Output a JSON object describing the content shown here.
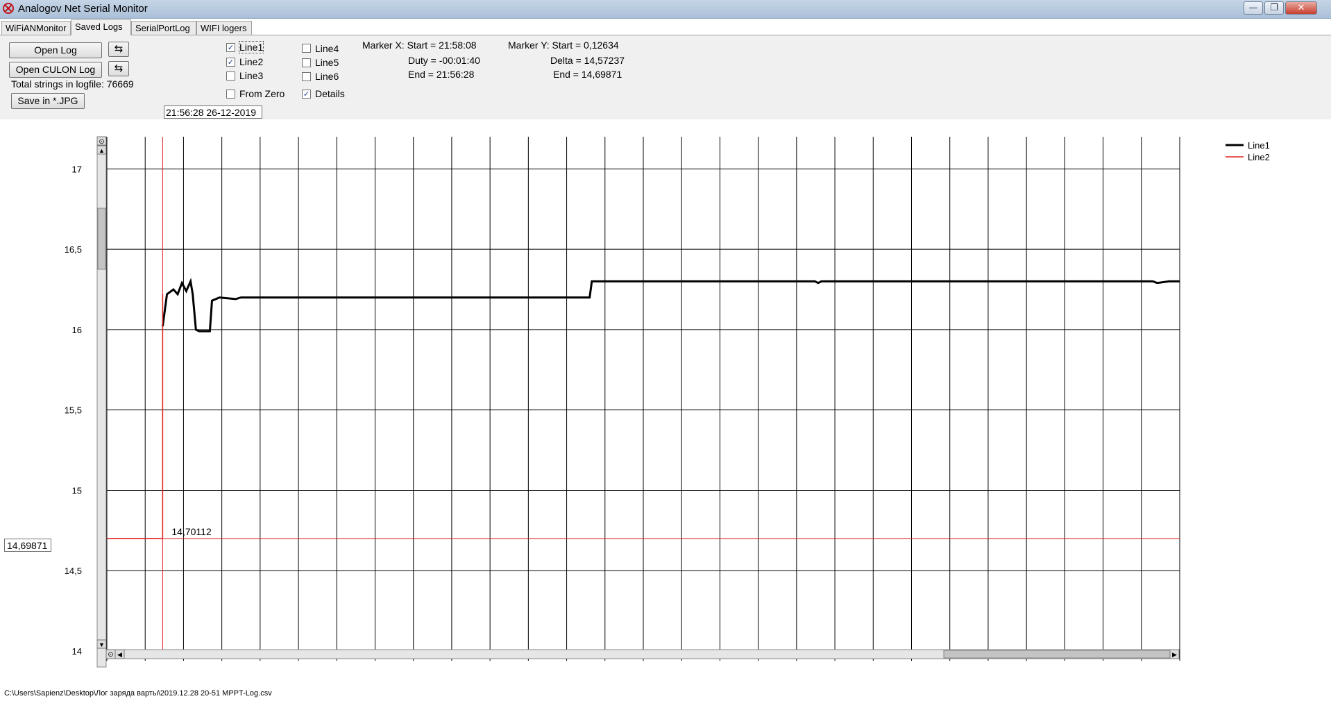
{
  "window": {
    "title": "Analogov Net Serial Monitor",
    "minimize_glyph": "—",
    "maximize_glyph": "❐",
    "close_glyph": "✕"
  },
  "tabs": [
    {
      "label": "WiFiANMonitor",
      "active": false
    },
    {
      "label": "Saved Logs",
      "active": true
    },
    {
      "label": "SerialPortLog",
      "active": false
    },
    {
      "label": "WIFI logers",
      "active": false
    }
  ],
  "controls": {
    "open_log": "Open Log",
    "open_culon_log": "Open CULON Log",
    "total_strings": "Total strings in logfile: 76669",
    "save_jpg": "Save in *.JPG",
    "refresh_glyph": "⇆",
    "date_time": "21:56:28 26-12-2019"
  },
  "checkboxes": [
    {
      "label": "Line1",
      "checked": true
    },
    {
      "label": "Line2",
      "checked": true
    },
    {
      "label": "Line3",
      "checked": false
    },
    {
      "label": "Line4",
      "checked": false
    },
    {
      "label": "Line5",
      "checked": false
    },
    {
      "label": "Line6",
      "checked": false
    },
    {
      "label": "From Zero",
      "checked": false
    },
    {
      "label": "Details",
      "checked": true
    }
  ],
  "marker_x": {
    "start": "Marker X: Start = 21:58:08",
    "duty": "Duty = -00:01:40",
    "end": "End  = 21:56:28"
  },
  "marker_y": {
    "start": "Marker Y: Start = 0,12634",
    "delta": "Delta = 14,57237",
    "end": "End  = 14,69871"
  },
  "plot": {
    "y_cursor_value": "14,69871",
    "marker_label": "14,70112"
  },
  "status_path": "C:\\Users\\Sapienz\\Desktop\\Лог заряда варты\\2019.12.28 20-51 MPPT-Log.csv",
  "chart_data": {
    "type": "line",
    "ylim": [
      14,
      17.2
    ],
    "y_ticks": [
      "14",
      "14,5",
      "15",
      "15,5",
      "16",
      "16,5",
      "17"
    ],
    "x_range": [
      0,
      100
    ],
    "grid": true,
    "legend_position": "top-right",
    "series": [
      {
        "name": "Line1",
        "color": "#000000",
        "points": [
          [
            5.2,
            16.02
          ],
          [
            5.6,
            16.22
          ],
          [
            6.2,
            16.25
          ],
          [
            6.6,
            16.22
          ],
          [
            7.0,
            16.29
          ],
          [
            7.4,
            16.24
          ],
          [
            7.8,
            16.3
          ],
          [
            8.0,
            16.22
          ],
          [
            8.3,
            16.0
          ],
          [
            8.6,
            15.99
          ],
          [
            9.6,
            15.99
          ],
          [
            9.8,
            16.18
          ],
          [
            10.5,
            16.2
          ],
          [
            12.0,
            16.19
          ],
          [
            12.5,
            16.2
          ],
          [
            45.0,
            16.2
          ],
          [
            45.2,
            16.3
          ],
          [
            66.0,
            16.3
          ],
          [
            66.3,
            16.29
          ],
          [
            66.6,
            16.3
          ],
          [
            97.5,
            16.3
          ],
          [
            97.9,
            16.29
          ],
          [
            99.0,
            16.3
          ],
          [
            100,
            16.3
          ]
        ]
      },
      {
        "name": "Line2",
        "color": "#e02020",
        "points": [
          [
            0,
            14.7
          ],
          [
            5.2,
            14.7
          ],
          [
            5.2,
            16.22
          ]
        ]
      }
    ],
    "horizontal_marker": {
      "value": 14.7,
      "color": "#e02020"
    },
    "vertical_marker": {
      "x": 5.2,
      "color": "#e02020"
    }
  }
}
